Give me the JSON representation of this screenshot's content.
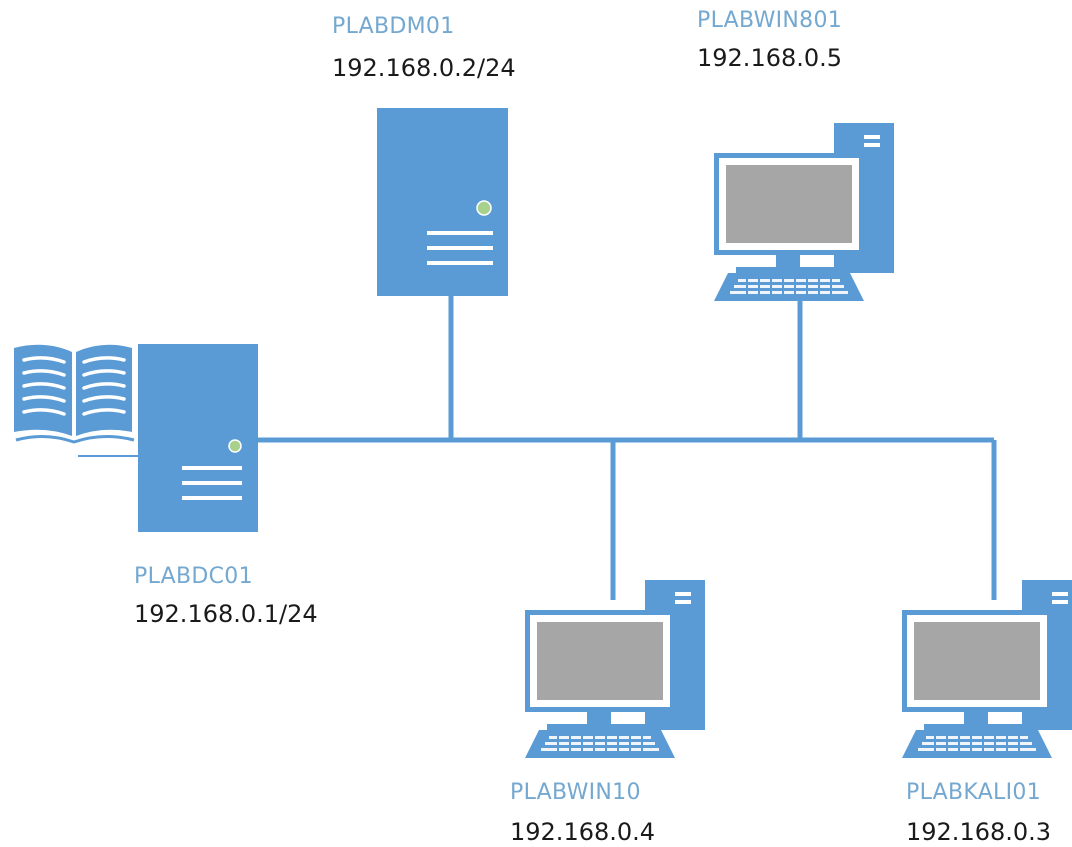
{
  "colors": {
    "device": "#5b9bd5",
    "screen": "#a6a6a6",
    "link": "#5b9bd5",
    "led": "#a9d18e",
    "name_text": "#74a8d0",
    "ip_text": "#1a1a1a"
  },
  "hosts": {
    "dc": {
      "name": "PLABDC01",
      "ip": "192.168.0.1/24",
      "kind": "domain-controller-server"
    },
    "dm": {
      "name": "PLABDM01",
      "ip": "192.168.0.2/24",
      "kind": "server"
    },
    "win801": {
      "name": "PLABWIN801",
      "ip": "192.168.0.5",
      "kind": "workstation"
    },
    "win10": {
      "name": "PLABWIN10",
      "ip": "192.168.0.4",
      "kind": "workstation"
    },
    "kali": {
      "name": "PLABKALI01",
      "ip": "192.168.0.3",
      "kind": "workstation"
    }
  },
  "icons": {
    "directory": "book-icon",
    "server": "server-tower-icon",
    "workstation": "desktop-computer-icon"
  }
}
